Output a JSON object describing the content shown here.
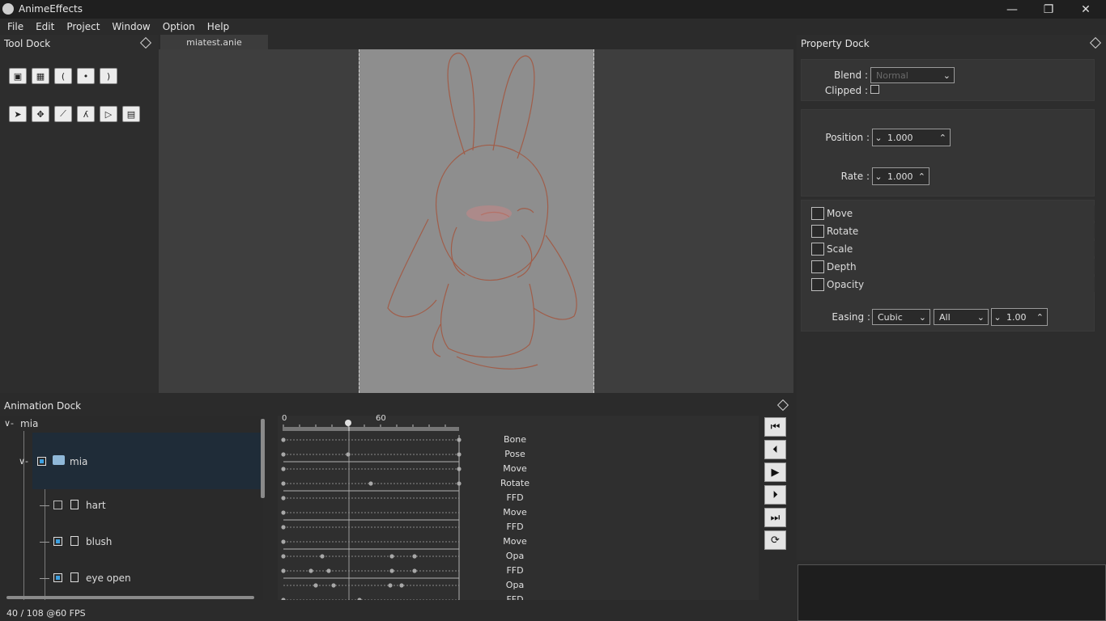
{
  "app": {
    "title": "AnimeEffects"
  },
  "window": {
    "minimize": "—",
    "maximize": "❐",
    "close": "✕"
  },
  "menu": [
    "File",
    "Edit",
    "Project",
    "Window",
    "Option",
    "Help"
  ],
  "tool_dock": {
    "title": "Tool Dock",
    "row1_icons": [
      "cube-icon",
      "image-icon",
      "curve-left-icon",
      "dot-icon",
      "curve-right-icon"
    ],
    "row2_icons": [
      "cursor-icon",
      "move-icon",
      "bone-icon",
      "pose-icon",
      "mesh-icon",
      "ffd-icon"
    ]
  },
  "editor": {
    "tab": "miatest.anie"
  },
  "property_dock": {
    "title": "Property Dock",
    "blend_label": "Blend :",
    "blend_value": "Normal",
    "clipped_label": "Clipped :",
    "position_label": "Position :",
    "position_value": "1.000",
    "rate_label": "Rate :",
    "rate_value": "1.000",
    "checks": [
      "Move",
      "Rotate",
      "Scale",
      "Depth",
      "Opacity"
    ],
    "easing_label": "Easing :",
    "easing_type": "Cubic",
    "easing_range": "All",
    "easing_value": "1.00"
  },
  "animation_dock": {
    "title": "Animation Dock",
    "root": "mia",
    "folder": "mia",
    "layers": [
      {
        "name": "hart",
        "checked": false
      },
      {
        "name": "blush",
        "checked": true
      },
      {
        "name": "eye open",
        "checked": true
      }
    ],
    "ruler": [
      "0",
      "60"
    ],
    "tracks": [
      "Bone",
      "Pose",
      "Move",
      "Rotate",
      "FFD",
      "Move",
      "FFD",
      "Move",
      "Opa",
      "FFD",
      "Opa",
      "FFD"
    ]
  },
  "status": {
    "frame_info": "40 / 108 @60 FPS"
  }
}
